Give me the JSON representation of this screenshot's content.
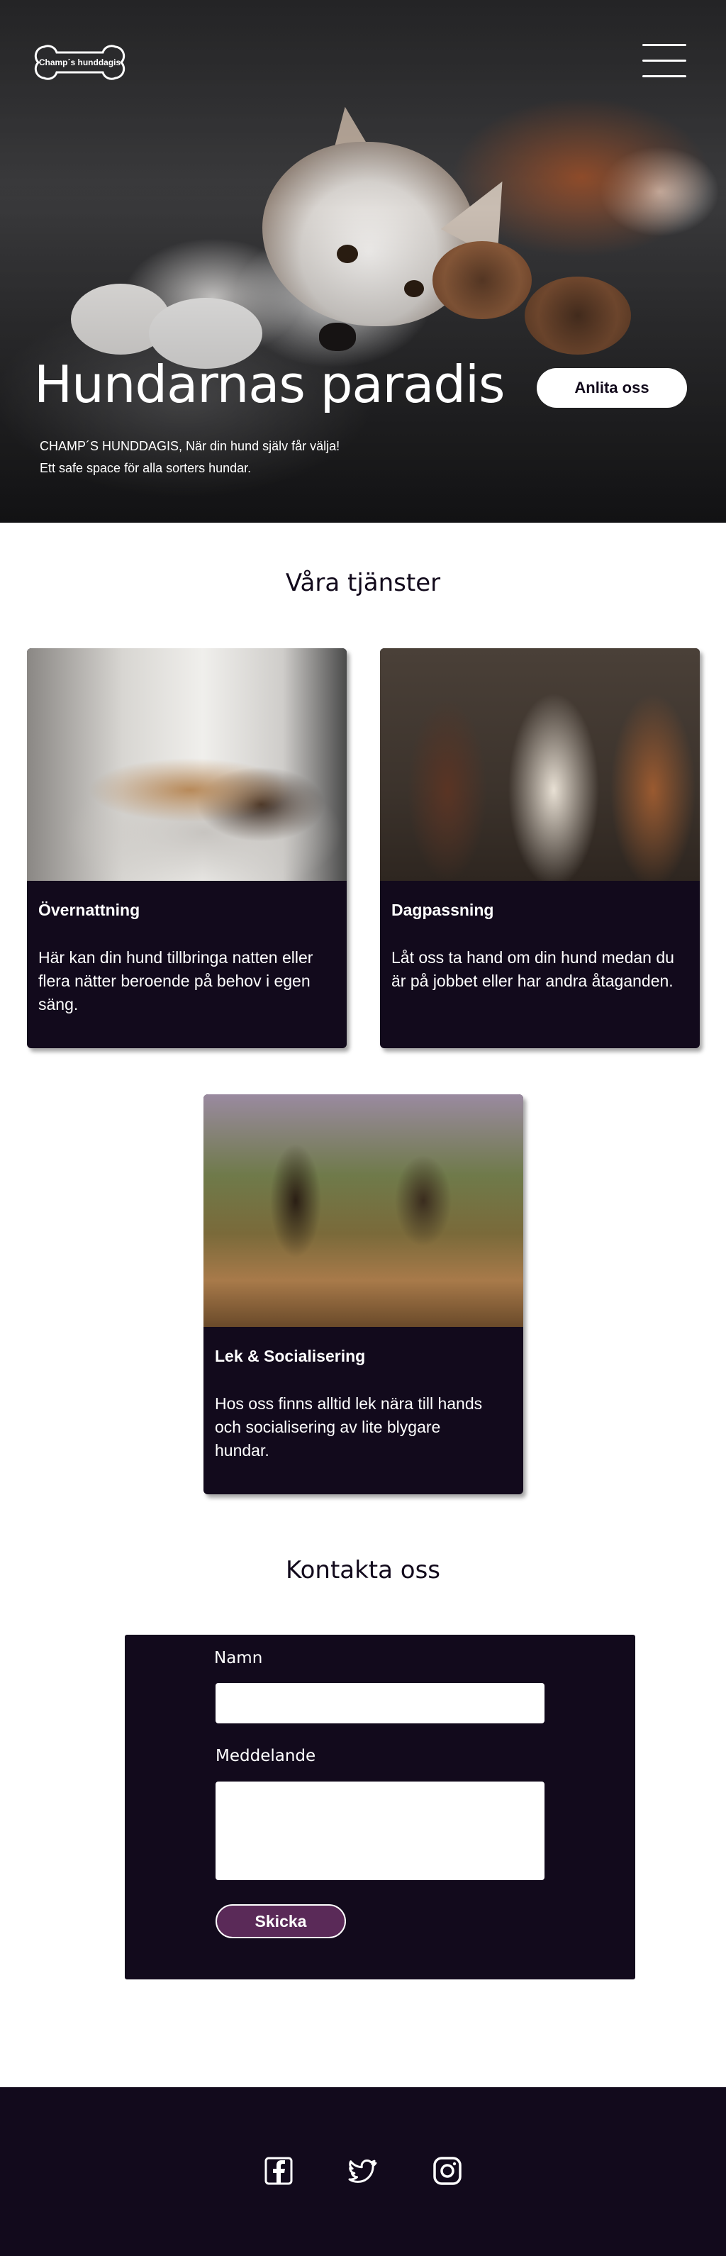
{
  "header": {
    "logo_text": "Champ´s hunddagis",
    "menu_icon": "hamburger-menu-icon"
  },
  "hero": {
    "title": "Hundarnas paradis",
    "cta_label": "Anlita oss",
    "subtitle_line1": "CHAMP´S HUNDDAGIS, När din hund själv får välja!",
    "subtitle_line2": "Ett safe space för alla sorters hundar."
  },
  "services": {
    "heading": "Våra tjänster",
    "items": [
      {
        "title": "Övernattning",
        "description": "Här kan din hund tillbringa natten eller flera nätter beroende på behov i egen säng."
      },
      {
        "title": "Dagpassning",
        "description": "Låt oss ta hand om din hund medan du är på jobbet eller har andra åtaganden."
      },
      {
        "title": "Lek & Socialisering",
        "description": "Hos oss finns alltid lek nära till hands och socialisering av lite blygare hundar."
      }
    ]
  },
  "contact": {
    "heading": "Kontakta oss",
    "name_label": "Namn",
    "name_value": "",
    "message_label": "Meddelande",
    "message_value": "",
    "submit_label": "Skicka"
  },
  "footer": {
    "social_icons": [
      "facebook-icon",
      "twitter-icon",
      "instagram-icon"
    ]
  },
  "colors": {
    "dark": "#120a1c",
    "accent": "#5a2a58",
    "white": "#ffffff"
  }
}
